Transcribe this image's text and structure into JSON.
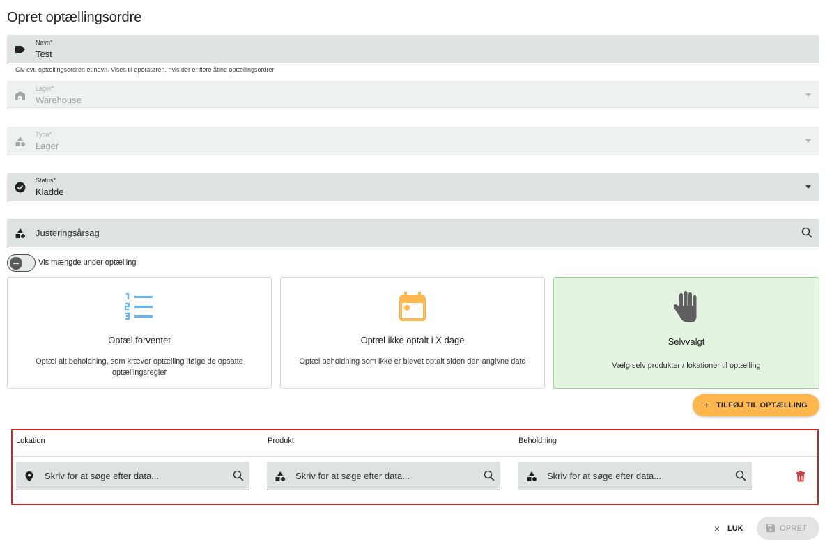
{
  "page": {
    "title": "Opret optællingsordre"
  },
  "form": {
    "name": {
      "label": "Navn*",
      "value": "Test",
      "helper": "Giv evt. optællingsordren et navn. Vises til operatøren, hvis der er flere åbne optællingsordrer"
    },
    "warehouse": {
      "label": "Lager*",
      "value": "Warehouse"
    },
    "type": {
      "label": "Type*",
      "value": "Lager"
    },
    "status": {
      "label": "Status*",
      "value": "Kladde"
    },
    "adjustment_reason": {
      "placeholder": "Justeringsårsag"
    }
  },
  "toggle": {
    "label": "Vis mængde under optælling",
    "on": false
  },
  "cards": [
    {
      "title": "Optæl forventet",
      "description": "Optæl alt beholdning, som kræver optælling ifølge de opsatte optællingsregler",
      "icon": "numbered-list-icon",
      "selected": false
    },
    {
      "title": "Optæl ikke optalt i X dage",
      "description": "Optæl beholdning som ikke er blevet optalt siden den angivne dato",
      "icon": "calendar-icon",
      "selected": false
    },
    {
      "title": "Selvvalgt",
      "description": "Vælg selv produkter / lokationer til optælling",
      "icon": "hand-icon",
      "selected": true
    }
  ],
  "add_button": {
    "label": "TILFØJ TIL OPTÆLLING"
  },
  "table": {
    "headers": [
      "Lokation",
      "Produkt",
      "Beholdning"
    ],
    "row": {
      "location_placeholder": "Skriv for at søge efter data...",
      "product_placeholder": "Skriv for at søge efter data...",
      "stock_placeholder": "Skriv for at søge efter data..."
    }
  },
  "footer": {
    "close_label": "LUK",
    "create_label": "OPRET"
  },
  "colors": {
    "accent": "#ffb74d",
    "selected_card": "#e3f4e1",
    "highlight_border": "#c62828",
    "icon_blue": "#64b5f6",
    "icon_orange": "#ffb74d",
    "delete": "#e53935"
  }
}
